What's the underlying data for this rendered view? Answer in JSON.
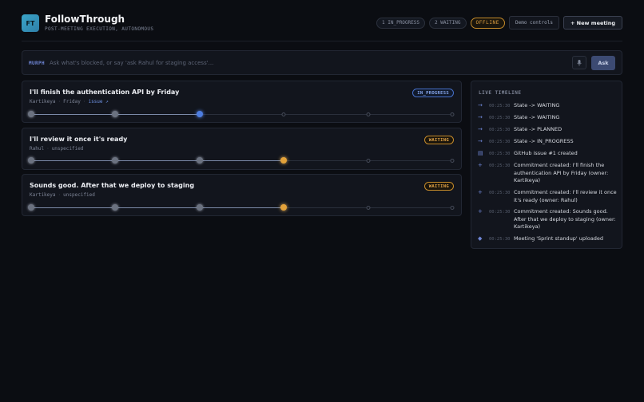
{
  "header": {
    "logo": "FT",
    "title": "FollowThrough",
    "subtitle": "POST-MEETING EXECUTION, AUTONOMOUS",
    "pills": {
      "in_progress": "1 IN_PROGRESS",
      "waiting": "2 WAITING",
      "offline": "OFFLINE"
    },
    "demo_label": "Demo controls",
    "new_meeting_label": "+ New meeting"
  },
  "askbar": {
    "label": "MURPH",
    "placeholder": "Ask what's blocked, or say 'ask Rahul for staging access'...",
    "mic_icon": "microphone-icon",
    "ask_label": "Ask"
  },
  "commitments": [
    {
      "title": "I'll finish the authentication API by Friday",
      "owner": "Kartikeya",
      "due": "Friday",
      "link": "issue ↗",
      "status": "IN_PROGRESS",
      "steps": [
        "done",
        "done",
        "active-blue",
        "pending",
        "pending",
        "pending"
      ]
    },
    {
      "title": "I'll review it once it's ready",
      "owner": "Rahul",
      "due": "unspecified",
      "status": "WAITING",
      "steps": [
        "done",
        "done",
        "done",
        "active-amber",
        "pending",
        "pending"
      ]
    },
    {
      "title": "Sounds good. After that we deploy to staging",
      "owner": "Kartikeya",
      "due": "unspecified",
      "status": "WAITING",
      "steps": [
        "done",
        "done",
        "done",
        "active-amber",
        "pending",
        "pending"
      ]
    }
  ],
  "timeline": {
    "title": "LIVE TIMELINE",
    "events": [
      {
        "icon": "arrow-icon",
        "glyph": "→",
        "time": "00:25:30",
        "text": "State -> WAITING"
      },
      {
        "icon": "arrow-icon",
        "glyph": "→",
        "time": "00:25:30",
        "text": "State -> WAITING"
      },
      {
        "icon": "arrow-icon",
        "glyph": "→",
        "time": "00:25:30",
        "text": "State -> PLANNED"
      },
      {
        "icon": "arrow-icon",
        "glyph": "→",
        "time": "00:25:30",
        "text": "State -> IN_PROGRESS"
      },
      {
        "icon": "document-icon",
        "glyph": "▤",
        "time": "00:25:30",
        "text": "GitHub issue #1 created"
      },
      {
        "icon": "plus-icon",
        "glyph": "+",
        "time": "00:25:30",
        "text": "Commitment created: I'll finish the authentication API by Friday (owner: Kartikeya)"
      },
      {
        "icon": "plus-icon",
        "glyph": "+",
        "time": "00:25:30",
        "text": "Commitment created: I'll review it once it's ready (owner: Rahul)"
      },
      {
        "icon": "plus-icon",
        "glyph": "+",
        "time": "00:25:30",
        "text": "Commitment created: Sounds good. After that we deploy to staging (owner: Kartikeya)"
      },
      {
        "icon": "diamond-icon",
        "glyph": "◆",
        "time": "00:25:30",
        "text": "Meeting 'Sprint standup' uploaded"
      }
    ]
  }
}
